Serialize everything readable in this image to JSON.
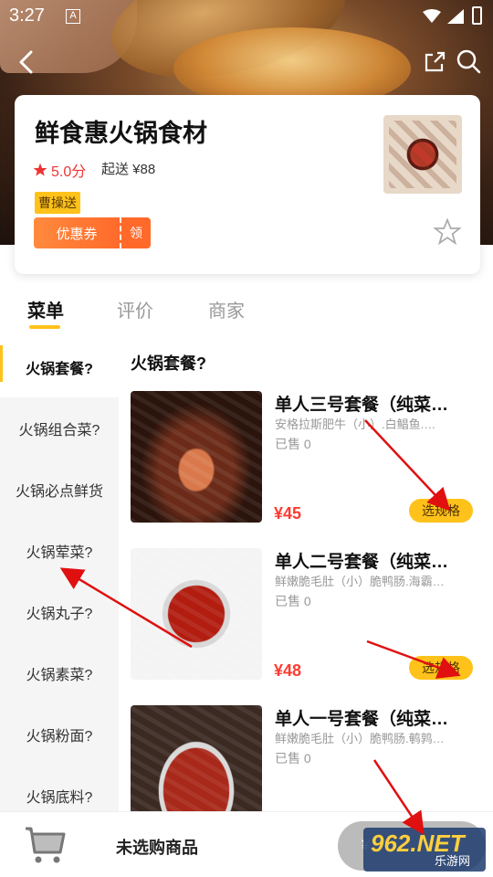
{
  "status_bar": {
    "time": "3:27",
    "notification_glyph": "A"
  },
  "header": {
    "back_icon": "back-arrow-icon",
    "share_icon": "share-icon",
    "search_icon": "search-icon"
  },
  "store": {
    "name": "鲜食惠火锅食材",
    "rating": "5.0分",
    "min_order": "起送 ¥88",
    "delivery_tag": "曹操送",
    "coupon_label": "优惠券",
    "coupon_claim": "领",
    "favorite_icon": "star-outline-icon"
  },
  "tabs": [
    {
      "label": "菜单",
      "active": true
    },
    {
      "label": "评价",
      "active": false
    },
    {
      "label": "商家",
      "active": false
    }
  ],
  "categories": [
    {
      "label": "火锅套餐?",
      "active": true
    },
    {
      "label": "火锅组合菜?"
    },
    {
      "label": "火锅必点鲜货"
    },
    {
      "label": "火锅荤菜?"
    },
    {
      "label": "火锅丸子?"
    },
    {
      "label": "火锅素菜?"
    },
    {
      "label": "火锅粉面?"
    },
    {
      "label": "火锅底料?"
    }
  ],
  "section_title": "火锅套餐?",
  "products": [
    {
      "name": "单人三号套餐（纯菜…",
      "desc": "安格拉斯肥牛（小）.白鲳鱼.…",
      "sold": "已售 0",
      "price": "¥45",
      "spec_label": "选规格"
    },
    {
      "name": "单人二号套餐（纯菜…",
      "desc": "鲜嫩脆毛肚（小）脆鸭肠.海霸…",
      "sold": "已售 0",
      "price": "¥48",
      "spec_label": "选规格"
    },
    {
      "name": "单人一号套餐（纯菜…",
      "desc": "鲜嫩脆毛肚（小）脆鸭肠.鹌鹑…",
      "sold": "已售 0",
      "price": "",
      "spec_label": ""
    }
  ],
  "cart": {
    "empty_text": "未选购商品",
    "checkout_prefix": "¥"
  },
  "watermark": {
    "big": "962.NET",
    "small": "乐游网"
  },
  "colors": {
    "accent": "#ffc21a",
    "price": "#ff3b30",
    "coupon": "#ff6a2b",
    "annotation": "#e01010"
  }
}
